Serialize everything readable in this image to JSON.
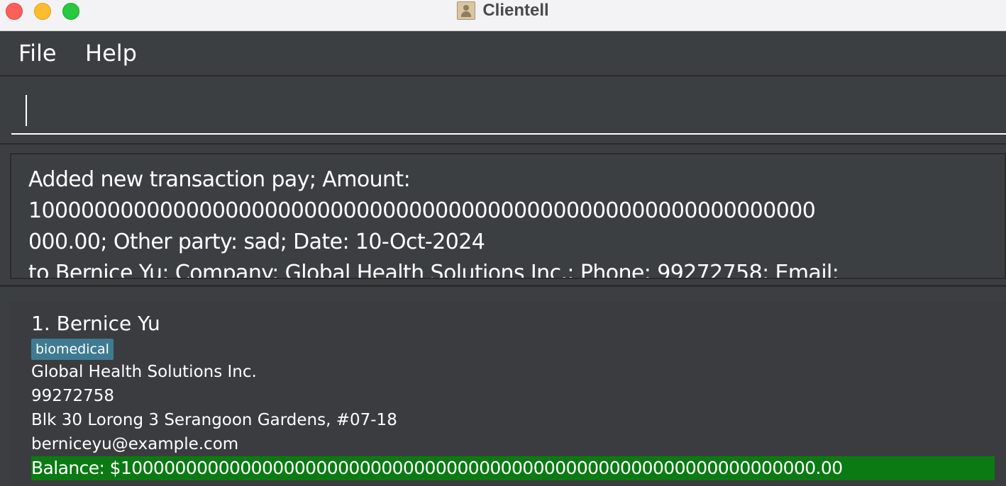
{
  "window": {
    "title": "Clientell",
    "controls": [
      "close",
      "minimize",
      "maximize"
    ]
  },
  "menu": {
    "items": [
      {
        "label": "File"
      },
      {
        "label": "Help"
      }
    ]
  },
  "command": {
    "value": ""
  },
  "result": {
    "lines": [
      "Added new transaction pay; Amount:",
      "100000000000000000000000000000000000000000000000000000000000",
      "000.00; Other party: sad; Date: 10-Oct-2024",
      "to Bernice Yu; Company: Global Health Solutions Inc.; Phone: 99272758; Email:"
    ]
  },
  "clients": [
    {
      "name": "1. Bernice Yu",
      "tag": "biomedical",
      "company": "Global Health Solutions Inc.",
      "phone": "99272758",
      "address": "Blk 30 Lorong 3 Serangoon Gardens, #07-18",
      "email": "berniceyu@example.com",
      "balance": "Balance: $1000000000000000000000000000000000000000000000000000000000000000.00"
    }
  ],
  "colors": {
    "window_bg": "#3c3f41",
    "tag_bg": "#3e7b91",
    "balance_bg": "#0b7a13",
    "titlebar_bg": "#f3f2f4"
  }
}
